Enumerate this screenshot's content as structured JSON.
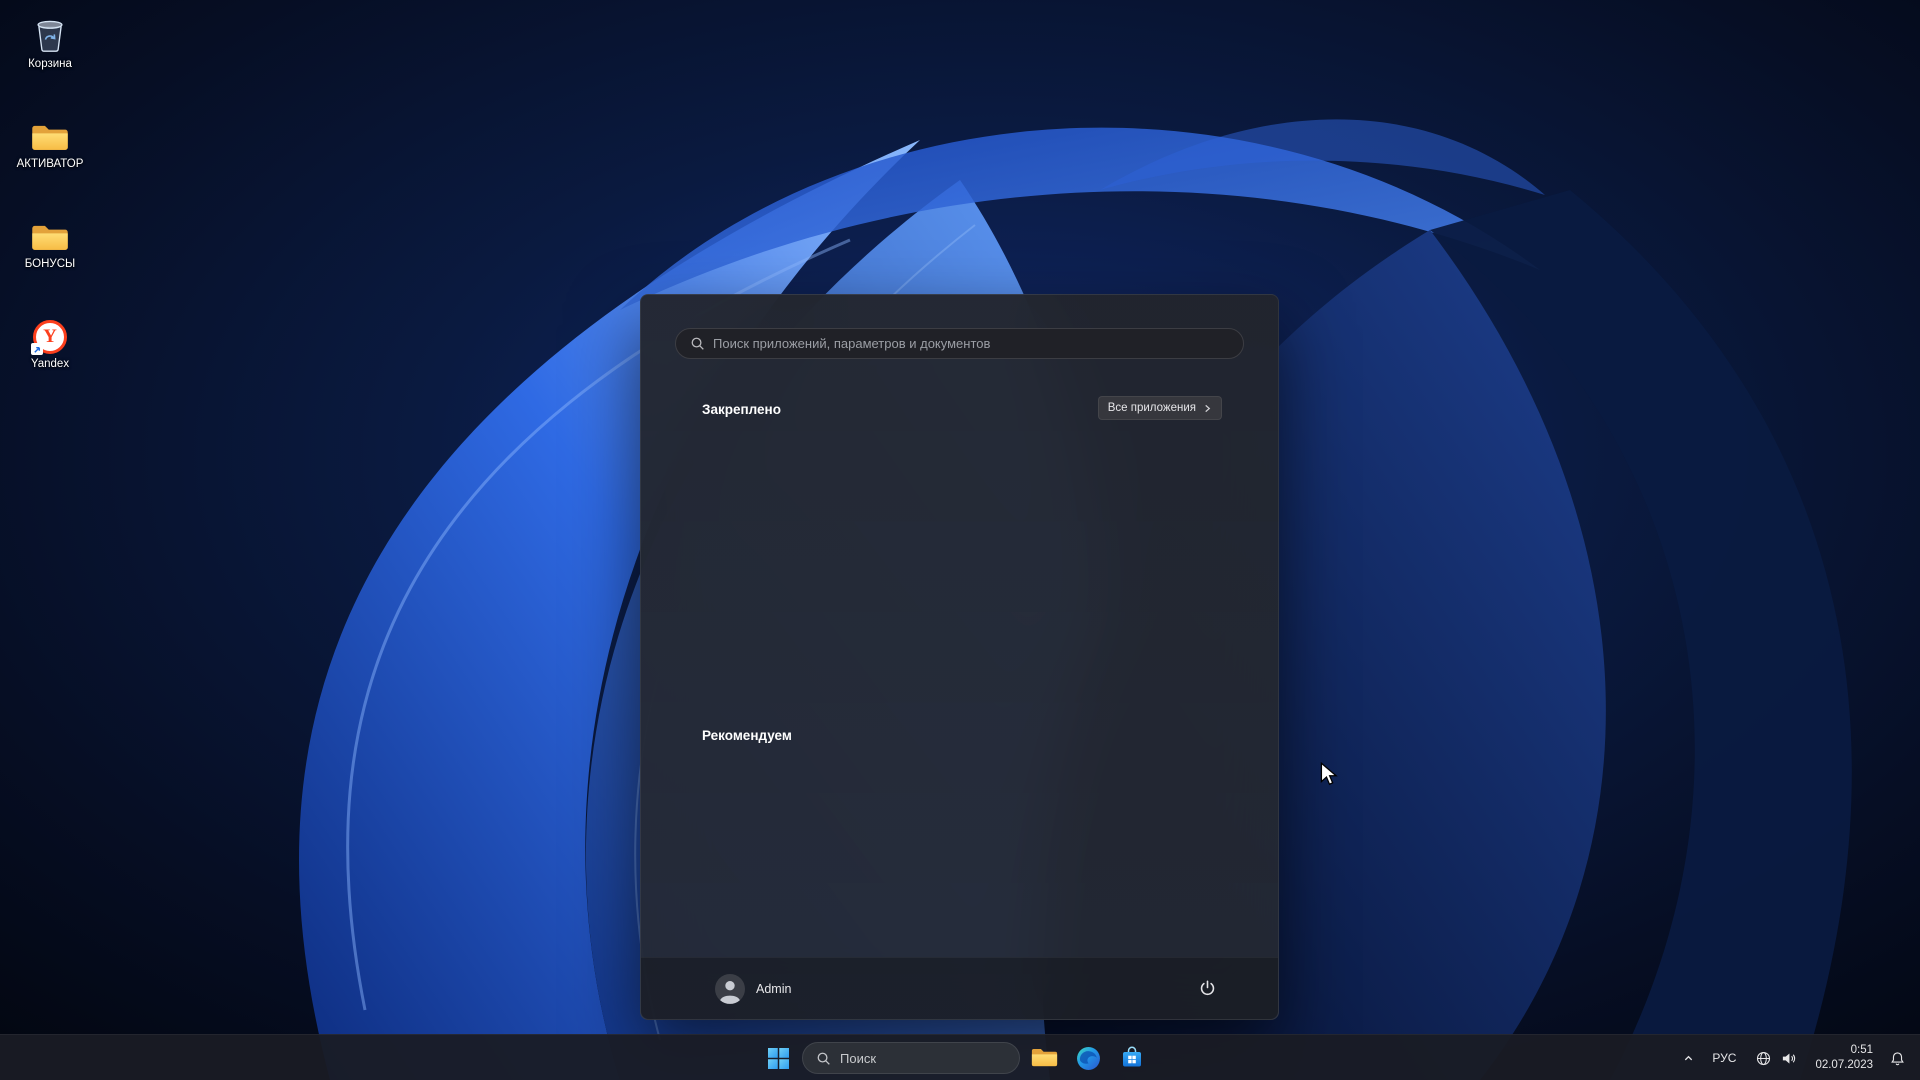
{
  "desktop": {
    "icons": [
      {
        "label": "Корзина",
        "icon": "recycle-bin-icon"
      },
      {
        "label": "АКТИВАТОР",
        "icon": "folder-icon"
      },
      {
        "label": "БОНУСЫ",
        "icon": "folder-icon"
      },
      {
        "label": "Yandex",
        "icon": "yandex-browser-icon"
      }
    ]
  },
  "start_menu": {
    "search_placeholder": "Поиск приложений, параметров и документов",
    "pinned_label": "Закреплено",
    "all_apps_label": "Все приложения",
    "recommended_label": "Рекомендуем",
    "user_name": "Admin"
  },
  "taskbar": {
    "search_label": "Поиск",
    "tray": {
      "language": "РУС",
      "time": "0:51",
      "date": "02.07.2023"
    }
  },
  "colors": {
    "accent_blue": "#4cc2ff",
    "taskbar_bg": "#191c24",
    "start_menu_bg": "#23252d",
    "folder_yellow": "#ffd55e",
    "yandex_red": "#fc3f1d"
  }
}
